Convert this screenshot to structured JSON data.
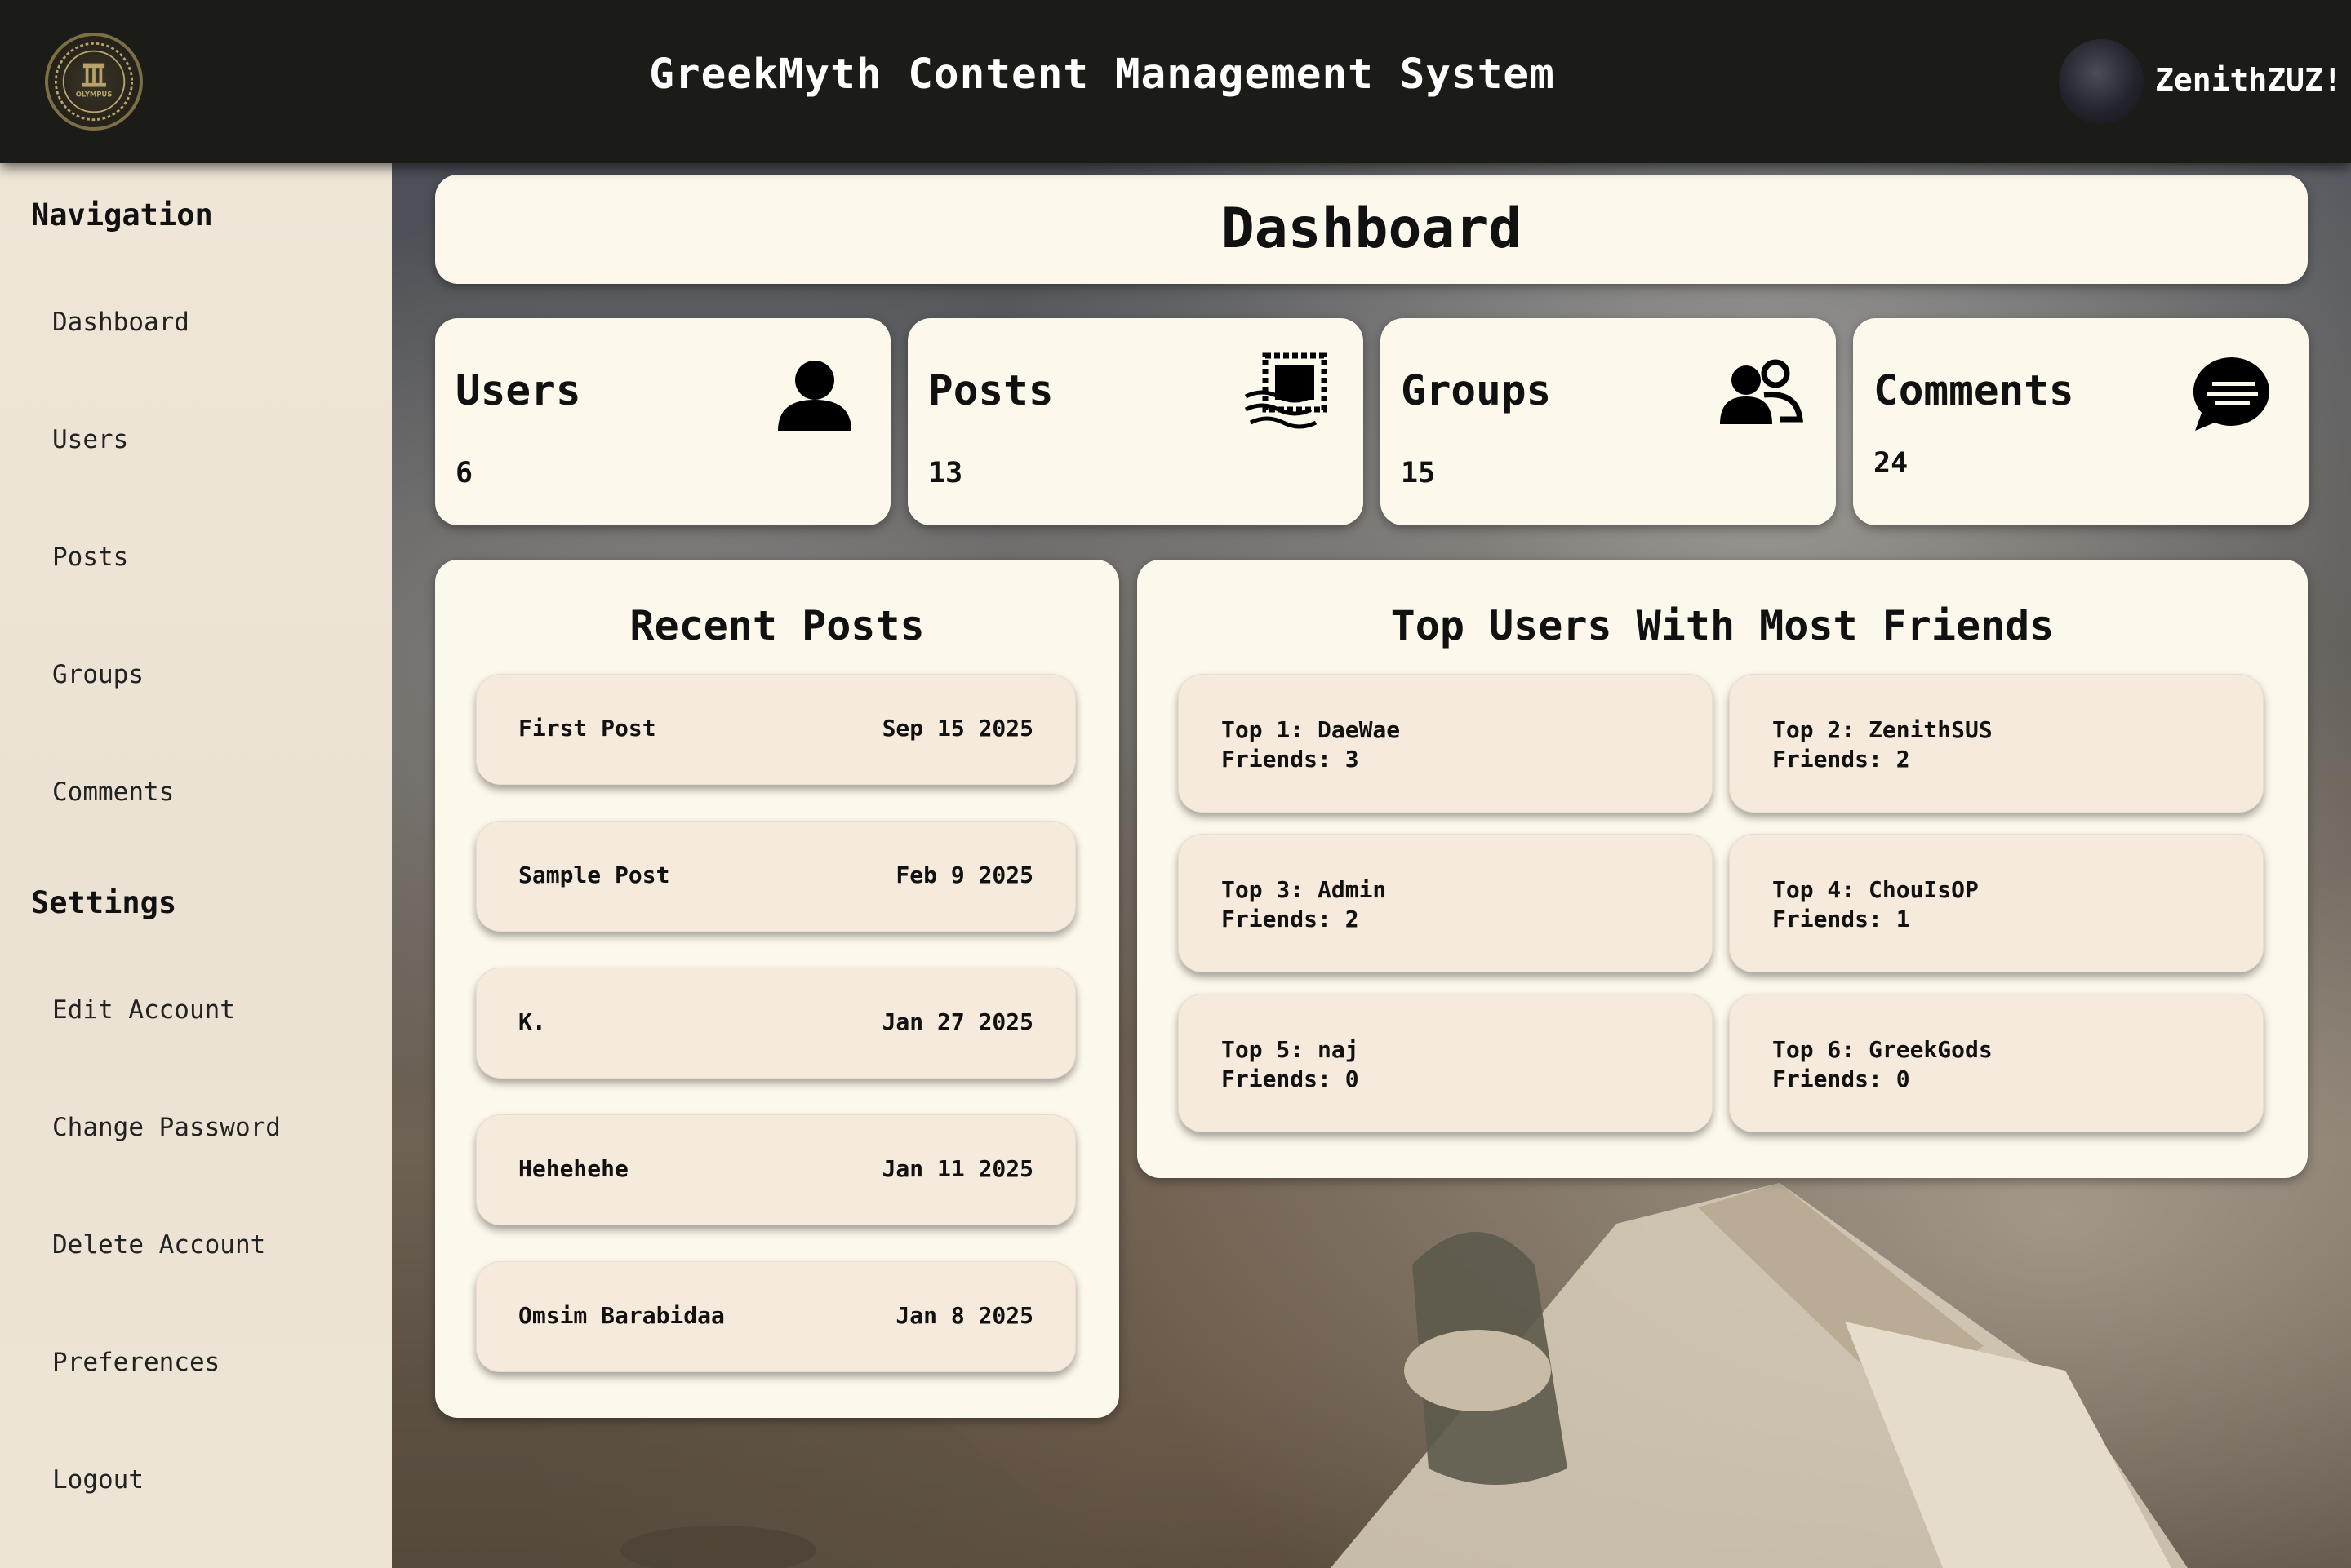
{
  "header": {
    "logo_text": "OLYMPUS",
    "title": "GreekMyth Content Management System",
    "username": "ZenithZUZ!"
  },
  "sidebar": {
    "navigation_heading": "Navigation",
    "navigation_items": [
      {
        "label": "Dashboard"
      },
      {
        "label": "Users"
      },
      {
        "label": "Posts"
      },
      {
        "label": "Groups"
      },
      {
        "label": "Comments"
      }
    ],
    "settings_heading": "Settings",
    "settings_items": [
      {
        "label": "Edit Account"
      },
      {
        "label": "Change Password"
      },
      {
        "label": "Delete Account"
      },
      {
        "label": "Preferences"
      },
      {
        "label": "Logout"
      }
    ]
  },
  "main": {
    "page_title": "Dashboard",
    "stats": [
      {
        "label": "Users",
        "value": "6",
        "icon": "user-icon"
      },
      {
        "label": "Posts",
        "value": "13",
        "icon": "post-stamp-icon"
      },
      {
        "label": "Groups",
        "value": "15",
        "icon": "group-icon"
      },
      {
        "label": "Comments",
        "value": "24",
        "icon": "comment-icon"
      }
    ],
    "recent_posts": {
      "title": "Recent Posts",
      "items": [
        {
          "title": "First Post",
          "date": "Sep 15 2025"
        },
        {
          "title": "Sample Post",
          "date": "Feb 9 2025"
        },
        {
          "title": "K.",
          "date": "Jan 27 2025"
        },
        {
          "title": "Hehehehe",
          "date": "Jan 11 2025"
        },
        {
          "title": "Omsim Barabidaa",
          "date": "Jan 8 2025"
        }
      ]
    },
    "top_users": {
      "title": "Top Users With Most Friends",
      "items": [
        {
          "rank_line": "Top 1: DaeWae",
          "friends_line": "Friends: 3"
        },
        {
          "rank_line": "Top 2: ZenithSUS",
          "friends_line": "Friends: 2"
        },
        {
          "rank_line": "Top 3: Admin",
          "friends_line": "Friends: 2"
        },
        {
          "rank_line": "Top 4: ChouIsOP",
          "friends_line": "Friends: 1"
        },
        {
          "rank_line": "Top 5: naj",
          "friends_line": "Friends: 0"
        },
        {
          "rank_line": "Top 6: GreekGods",
          "friends_line": "Friends: 0"
        }
      ]
    }
  },
  "colors": {
    "header_bg": "#1b1b17",
    "sidebar_bg": "#ede4d6",
    "panel_bg": "#fdf8ec",
    "item_bg": "#f5eadb",
    "logo_gold": "#b8a46a"
  }
}
